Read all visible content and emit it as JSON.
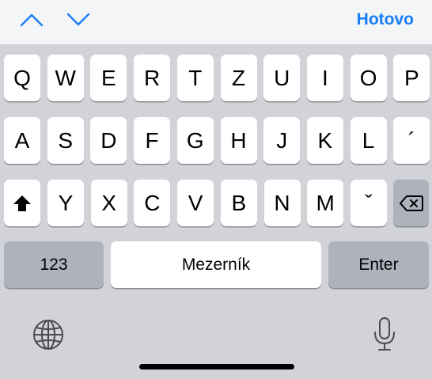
{
  "toolbar": {
    "prev_icon": "chevron-up-icon",
    "next_icon": "chevron-down-icon",
    "done_label": "Hotovo",
    "accent_color": "#1a7ef6"
  },
  "keyboard": {
    "row1": [
      "Q",
      "W",
      "E",
      "R",
      "T",
      "Z",
      "U",
      "I",
      "O",
      "P"
    ],
    "row2": [
      "A",
      "S",
      "D",
      "F",
      "G",
      "H",
      "J",
      "K",
      "L",
      "´"
    ],
    "row3": [
      "Y",
      "X",
      "C",
      "V",
      "B",
      "N",
      "M",
      "ˇ"
    ],
    "shift_icon": "shift-icon",
    "backspace_icon": "backspace-icon",
    "numbers_label": "123",
    "space_label": "Mezerník",
    "enter_label": "Enter",
    "globe_icon": "globe-icon",
    "mic_icon": "microphone-icon"
  },
  "colors": {
    "keyboard_bg": "#d1d3d9",
    "key_bg": "#ffffff",
    "special_key_bg": "#adb2bc",
    "toolbar_bg": "#f4f5f7"
  }
}
